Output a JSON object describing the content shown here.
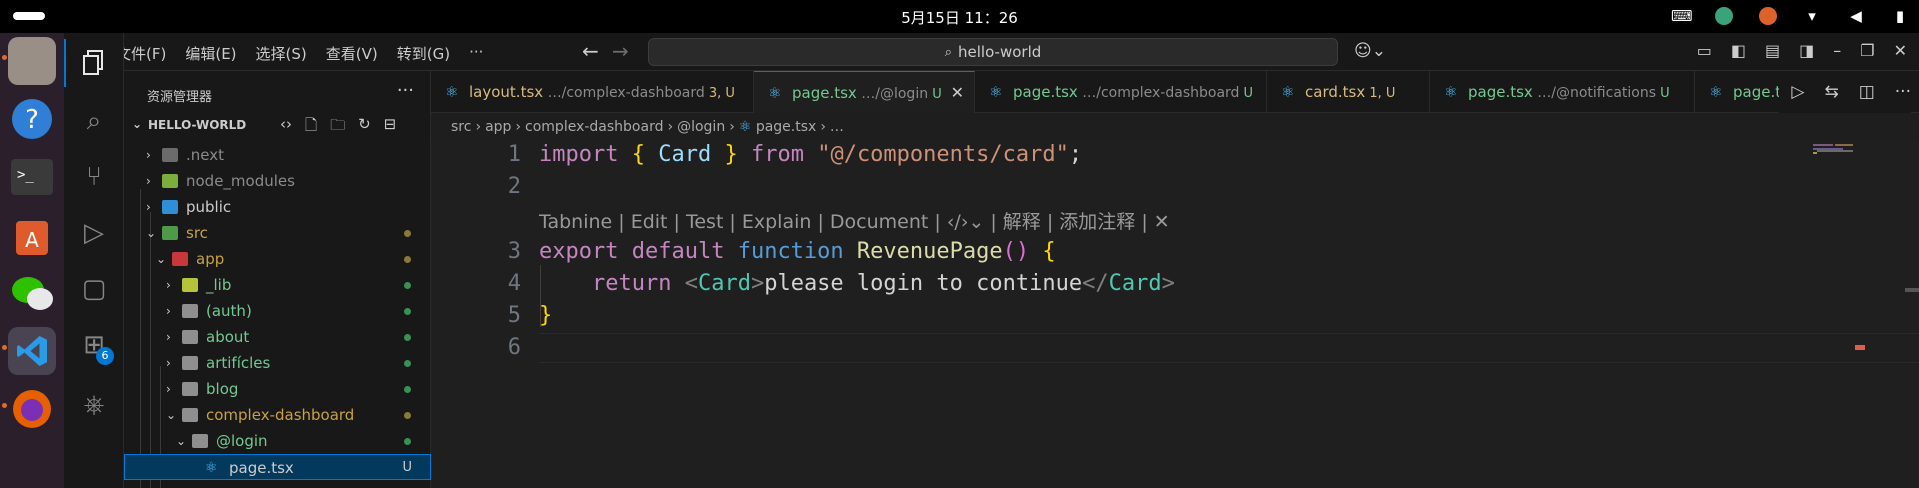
{
  "system": {
    "clock": "5月15日  11：26"
  },
  "menu": {
    "items": [
      "文件(F)",
      "编辑(E)",
      "选择(S)",
      "查看(V)",
      "转到(G)",
      "···"
    ],
    "search": "hello-world"
  },
  "explorer": {
    "title": "资源管理器",
    "more": "···",
    "root": "HELLO-WORLD",
    "items": [
      {
        "label": ".next",
        "color": "#8b8b8b",
        "chev": "›",
        "dot": ""
      },
      {
        "label": "node_modules",
        "color": "#8b8b8b",
        "chev": "›",
        "dot": ""
      },
      {
        "label": "public",
        "color": "#cccccc",
        "chev": "›",
        "dot": ""
      },
      {
        "label": "src",
        "color": "#c9a23e",
        "chev": "⌄",
        "dot": "#8a7a3a"
      },
      {
        "label": "app",
        "color": "#c9a23e",
        "chev": "⌄",
        "dot": "#8a7a3a"
      },
      {
        "label": "_lib",
        "color": "#73c991",
        "chev": "›",
        "dot": "#3c8f55"
      },
      {
        "label": "(auth)",
        "color": "#73c991",
        "chev": "›",
        "dot": "#3c8f55"
      },
      {
        "label": "about",
        "color": "#73c991",
        "chev": "›",
        "dot": "#3c8f55"
      },
      {
        "label": "artifícles",
        "color": "#73c991",
        "chev": "›",
        "dot": "#3c8f55"
      },
      {
        "label": "blog",
        "color": "#73c991",
        "chev": "›",
        "dot": "#3c8f55"
      },
      {
        "label": "complex-dashboard",
        "color": "#c9a23e",
        "chev": "⌄",
        "dot": "#8a7a3a"
      },
      {
        "label": "@login",
        "color": "#73c991",
        "chev": "⌄",
        "dot": "#3c8f55"
      },
      {
        "label": "page.tsx",
        "color": "#cccccc",
        "chev": "",
        "dot": "",
        "status": "U"
      }
    ]
  },
  "tabs": [
    {
      "name": "layout.tsx",
      "path": " …/complex-dashboard",
      "status": " 3, U",
      "name_color": "#d7ba7d",
      "status_color": "#d7ba7d"
    },
    {
      "name": "page.tsx",
      "path": " …/@login",
      "status": " U",
      "name_color": "#73c991",
      "status_color": "#73c991",
      "close": "✕"
    },
    {
      "name": "page.tsx",
      "path": " …/complex-dashboard",
      "status": " U",
      "name_color": "#73c991",
      "status_color": "#73c991"
    },
    {
      "name": "card.tsx",
      "path": "",
      "status": " 1, U",
      "name_color": "#d7ba7d",
      "status_color": "#d7ba7d"
    },
    {
      "name": "page.tsx",
      "path": " …/@notifications",
      "status": " U",
      "name_color": "#73c991",
      "status_color": "#73c991"
    },
    {
      "name": "page.ts",
      "path": "",
      "status": "",
      "name_color": "#73c991",
      "status_color": "#73c991"
    }
  ],
  "breadcrumb": [
    "src",
    "app",
    "complex-dashboard",
    "@login",
    "page.tsx",
    "…"
  ],
  "editor": {
    "line_numbers": [
      "1",
      "2",
      "3",
      "4",
      "5",
      "6"
    ],
    "codelens": "Tabnine | Edit | Test | Explain | Document | ‹/›⌄ | 解释 | 添加注释 | ✕",
    "code": {
      "l1_import": "import",
      "l1_card": "Card",
      "l1_from": "from",
      "l1_str": "\"@/components/card\"",
      "l3_export": "export",
      "l3_default": "default",
      "l3_function": "function",
      "l3_name": "RevenuePage",
      "l4_return": "return",
      "l4_tag": "Card",
      "l4_text": "please login to continue"
    }
  }
}
